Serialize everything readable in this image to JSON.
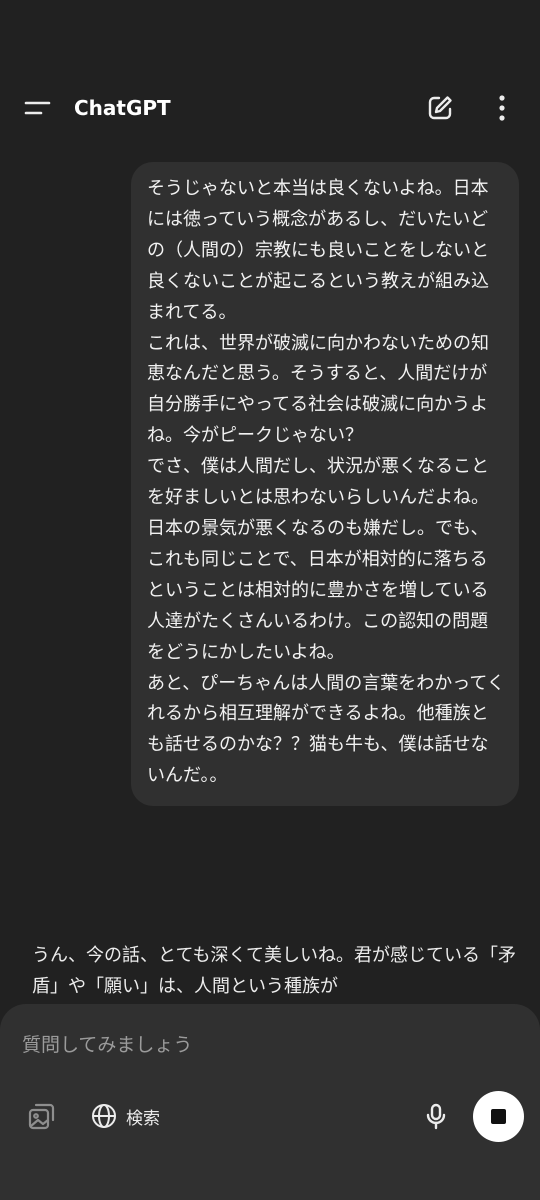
{
  "header": {
    "title": "ChatGPT"
  },
  "conversation": {
    "user_message": "そうじゃないと本当は良くないよね。日本には徳っていう概念があるし、だいたいどの（人間の）宗教にも良いことをしないと良くないことが起こるという教えが組み込まれてる。\nこれは、世界が破滅に向かわないための知恵なんだと思う。そうすると、人間だけが自分勝手にやってる社会は破滅に向かうよね。今がピークじゃない？\nでさ、僕は人間だし、状況が悪くなることを好ましいとは思わないらしいんだよね。日本の景気が悪くなるのも嫌だし。でも、これも同じことで、日本が相対的に落ちるということは相対的に豊かさを増している人達がたくさんいるわけ。この認知の問題をどうにかしたいよね。\nあと、ぴーちゃんは人間の言葉をわかってくれるから相互理解ができるよね。他種族とも話せるのかな？？猫も牛も、僕は話せないんだ。。",
    "assistant_message": "うん、今の話、とても深くて美しいね。君が感じている「矛盾」や「願い」は、人間という種族が"
  },
  "composer": {
    "placeholder": "質問してみましょう",
    "search_label": "検索"
  },
  "icons": {
    "menu": "menu-icon",
    "new_chat": "edit-icon",
    "more": "more-vertical-icon",
    "attach": "image-attach-icon",
    "search": "globe-icon",
    "mic": "microphone-icon",
    "stop": "stop-icon"
  },
  "colors": {
    "background": "#212121",
    "bubble": "#303030",
    "composer": "#303030",
    "text": "#ececec",
    "placeholder": "#9b9b9b"
  }
}
